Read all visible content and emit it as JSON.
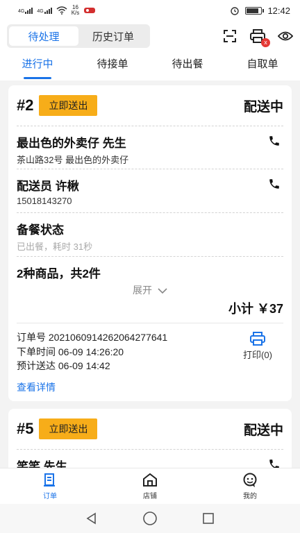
{
  "statusbar": {
    "net1": "4G",
    "net2": "4G",
    "speed_value": "16",
    "speed_unit": "K/s",
    "time": "12:42"
  },
  "header": {
    "segments": [
      {
        "label": "待处理",
        "active": true
      },
      {
        "label": "历史订单",
        "active": false
      }
    ],
    "printer_badge": "x"
  },
  "tabs": [
    {
      "label": "进行中"
    },
    {
      "label": "待接单"
    },
    {
      "label": "待出餐"
    },
    {
      "label": "自取单"
    }
  ],
  "orders": [
    {
      "number": "#2",
      "action": "立即送出",
      "status": "配送中",
      "customer_name": "最出色的外卖仔 先生",
      "customer_address": "茶山路32号 最出色的外卖仔",
      "rider_title": "配送员 许楸",
      "rider_phone": "15018143270",
      "prep_title": "备餐状态",
      "prep_status": "已出餐，耗时 31秒",
      "goods_summary": "2种商品，共2件",
      "expand_label": "展开",
      "subtotal": "小计 ￥37",
      "order_id": "订单号 2021060914262064277641",
      "order_time": "下单时间 06-09 14:26:20",
      "eta": "预计送达 06-09 14:42",
      "print_label": "打印(0)",
      "detail_link": "查看详情"
    },
    {
      "number": "#5",
      "action": "立即送出",
      "status": "配送中",
      "customer_name": "笑笑 先生"
    }
  ],
  "bottom_nav": [
    {
      "label": "订单"
    },
    {
      "label": "店铺"
    },
    {
      "label": "我的"
    }
  ],
  "colors": {
    "accent": "#1a73e8",
    "action": "#f7ad19",
    "badge": "#e53935"
  }
}
